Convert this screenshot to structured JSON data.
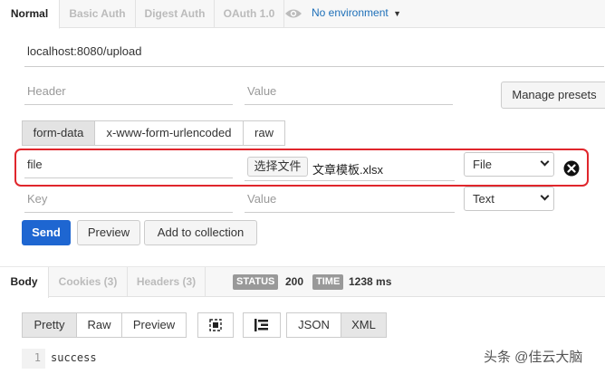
{
  "auth_tabs": [
    {
      "label": "Normal",
      "active": true
    },
    {
      "label": "Basic Auth",
      "active": false
    },
    {
      "label": "Digest Auth",
      "active": false
    },
    {
      "label": "OAuth 1.0",
      "active": false
    }
  ],
  "environment": {
    "label": "No environment"
  },
  "request": {
    "url": "localhost:8080/upload"
  },
  "headers": {
    "key_placeholder": "Header",
    "value_placeholder": "Value",
    "manage_presets": "Manage presets"
  },
  "body_modes": [
    "form-data",
    "x-www-form-urlencoded",
    "raw"
  ],
  "form_rows": [
    {
      "key": "file",
      "choose_button": "选择文件",
      "file_name": "文章模板.xlsx",
      "type": "File"
    },
    {
      "key_placeholder": "Key",
      "value_placeholder": "Value",
      "type": "Text"
    }
  ],
  "actions": {
    "send": "Send",
    "preview": "Preview",
    "add_to_collection": "Add to collection"
  },
  "response_tabs": [
    {
      "label": "Body",
      "active": true
    },
    {
      "label": "Cookies (3)",
      "active": false
    },
    {
      "label": "Headers (3)",
      "active": false
    }
  ],
  "status": {
    "status_label": "STATUS",
    "status_value": "200",
    "time_label": "TIME",
    "time_value": "1238 ms"
  },
  "view_modes": [
    "Pretty",
    "Raw",
    "Preview"
  ],
  "formats": [
    "JSON",
    "XML"
  ],
  "response_body": {
    "line_number": "1",
    "text": "success"
  },
  "watermark": "头条 @佳云大脑",
  "colors": {
    "send": "#1e66d1",
    "highlight_box": "#e0262c",
    "env_link": "#1d6fb8"
  }
}
